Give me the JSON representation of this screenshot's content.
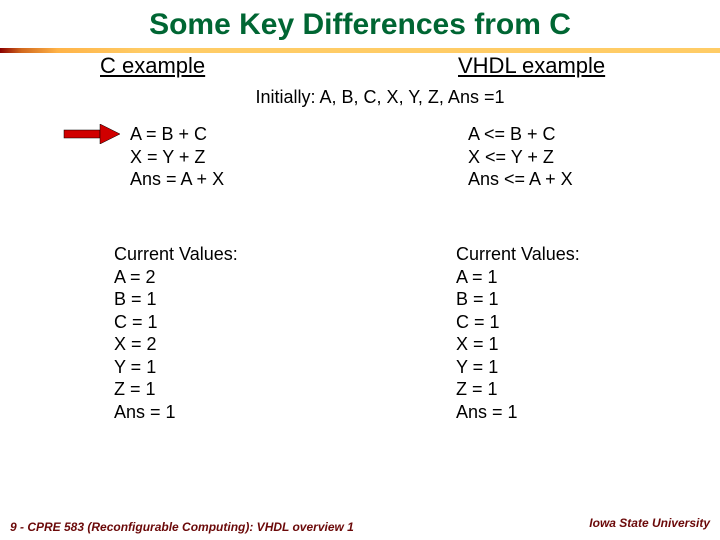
{
  "title": "Some Key Differences from C",
  "headers": {
    "left": "C example",
    "right": "VHDL example"
  },
  "initially": "Initially: A, B, C, X, Y, Z, Ans =1",
  "c_code": "A = B + C\nX = Y + Z\nAns = A + X",
  "vhdl_code": "A <= B + C\nX <= Y + Z\nAns <= A + X",
  "c_values": "Current Values:\nA = 2\nB = 1\nC = 1\nX = 2\nY = 1\nZ = 1\nAns = 1",
  "vhdl_values": "Current Values:\nA = 1\nB = 1\nC = 1\nX = 1\nY = 1\nZ = 1\nAns = 1",
  "footer": {
    "left": "9 - CPRE 583 (Reconfigurable Computing):  VHDL overview 1",
    "right": "Iowa State University"
  }
}
